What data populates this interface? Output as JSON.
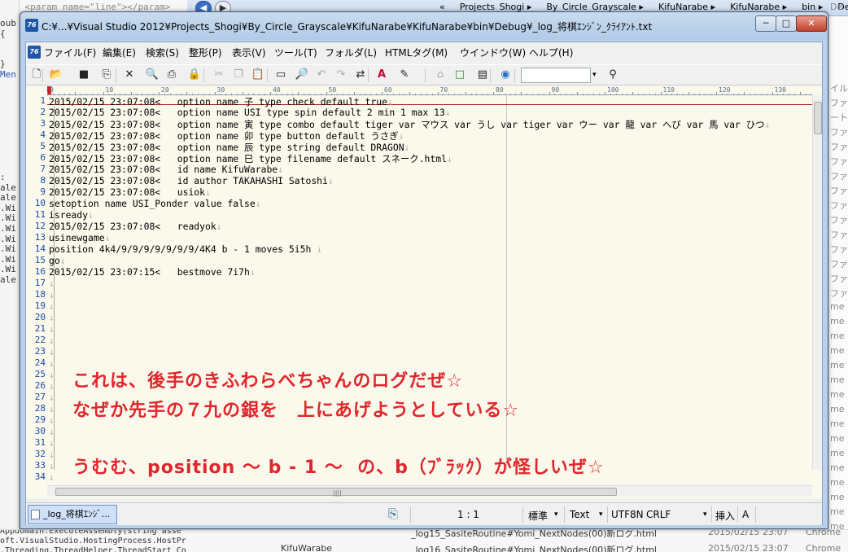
{
  "background": {
    "code_top": "/// <param name=\"line\"></param>",
    "left_fragments": [
      "oub",
      "{",
      "",
      "",
      "}",
      "Men",
      "",
      "",
      "",
      "",
      "",
      "",
      "",
      "",
      "",
      ":",
      "ale",
      "ale",
      ".Wi",
      ".Wi",
      ".Wi",
      ".Wi",
      ".Wi",
      ".Wi",
      ".Wi",
      "ale"
    ],
    "path": [
      "«",
      "Projects_Shogi",
      "By_Circle_Grayscale",
      "KifuNarabe",
      "KifuNarabe",
      "bin",
      "Debug"
    ],
    "right_search": "De",
    "right_fragments": [
      "イル",
      "ファ",
      "ート",
      "ファ",
      "ファ",
      "ファ",
      "ファ",
      "ファ",
      "ファ",
      "ファ",
      "ファ",
      "ファ",
      "ファ",
      "ファ",
      "ファ",
      "me",
      "me",
      "me",
      "me",
      "me",
      "me",
      "me",
      "me",
      "me",
      "me",
      "me",
      "me",
      "me",
      "me",
      "me",
      "me",
      "me",
      "Chrome"
    ],
    "bottom_left": [
      "Appdomain.ExecuteAssembly(string asse",
      "oft.VisualStudio.HostingProcess.HostPr",
      ".Threading.ThreadHelper.ThreadStart_Co"
    ],
    "bottom_files": [
      {
        "name": "_log15_SasiteRoutine#Yomi_NextNodes(00)新ログ.html",
        "date": "2015/02/15 23:07",
        "app": "Chrome"
      },
      {
        "name": "_log16_SasiteRoutine#Yomi_NextNodes(00)新ログ.html",
        "date": "2015/02/15 23:07",
        "app": "Chrome"
      }
    ],
    "bottom_folder": "KifuWarabe"
  },
  "window": {
    "title": "C:¥...¥Visual Studio 2012¥Projects_Shogi¥By_Circle_Grayscale¥KifuNarabe¥KifuNarabe¥bin¥Debug¥_log_将棋ｴﾝｼﾞﾝ_ｸﾗｲｱﾝﾄ.txt",
    "min": "─",
    "max": "□",
    "close": "✕"
  },
  "menu": [
    "ファイル(F)",
    "編集(E)",
    "検索(S)",
    "整形(P)",
    "表示(V)",
    "ツール(T)",
    "フォルダ(L)",
    "HTMLタグ(M)",
    "ウインドウ(W)",
    "ヘルプ(H)"
  ],
  "toolbar": {
    "icons": [
      "new-file-icon",
      "open-folder-icon",
      "save-icon",
      "save-all-icon",
      "close-icon",
      "print-preview-icon",
      "print-icon",
      "lock-icon",
      "cut-icon",
      "copy-icon",
      "paste-icon",
      "select-box-icon",
      "find-icon",
      "find-prev-icon",
      "find-next-icon",
      "replace-icon",
      "font-color-icon",
      "highlight-icon",
      "tag-icon",
      "border-icon",
      "view-icon",
      "browser-icon"
    ],
    "search_value": ""
  },
  "ruler": [
    "0",
    "10",
    "20",
    "30",
    "40",
    "50",
    "60",
    "70",
    "80",
    "90",
    "100",
    "110",
    "120",
    "130"
  ],
  "lines": [
    "2015/02/15 23:07:08<   option name 子 type check default true",
    "2015/02/15 23:07:08<   option name USI type spin default 2 min 1 max 13",
    "2015/02/15 23:07:08<   option name 寅 type combo default tiger var マウス var うし var tiger var ウー var 龍 var へび var 馬 var ひつ",
    "2015/02/15 23:07:08<   option name 卯 type button default うさぎ",
    "2015/02/15 23:07:08<   option name 辰 type string default DRAGON",
    "2015/02/15 23:07:08<   option name 巳 type filename default スネーク.html",
    "2015/02/15 23:07:08<   id name KifuWarabe",
    "2015/02/15 23:07:08<   id author TAKAHASHI Satoshi",
    "2015/02/15 23:07:08<   usiok",
    "setoption name USI_Ponder value false",
    "isready",
    "2015/02/15 23:07:08<   readyok",
    "usinewgame",
    "position 4k4/9/9/9/9/9/9/9/4K4 b - 1 moves 5i5h ",
    "go",
    "2015/02/15 23:07:15<   bestmove 7i7h",
    "",
    "",
    "",
    "",
    "",
    "",
    "",
    "",
    "",
    "",
    "",
    "",
    "",
    "",
    "",
    "",
    "",
    ""
  ],
  "annotations": [
    "これは、後手のきふわらべちゃんのログだぜ☆",
    "なぜか先手の７九の銀を　上にあげようとしている☆",
    "うむむ、position ～ b - 1 ～  の、b（ﾌﾞﾗｯｸ）が怪しいぜ☆",
    "～"
  ],
  "status": {
    "tab_label": "_log_将棋ｴﾝｼﾞ...",
    "position": "1 : 1",
    "mode": "標準",
    "type": "Text",
    "encoding": "UTF8N",
    "newline": "CRLF",
    "insert": "挿入",
    "ime": "A"
  }
}
